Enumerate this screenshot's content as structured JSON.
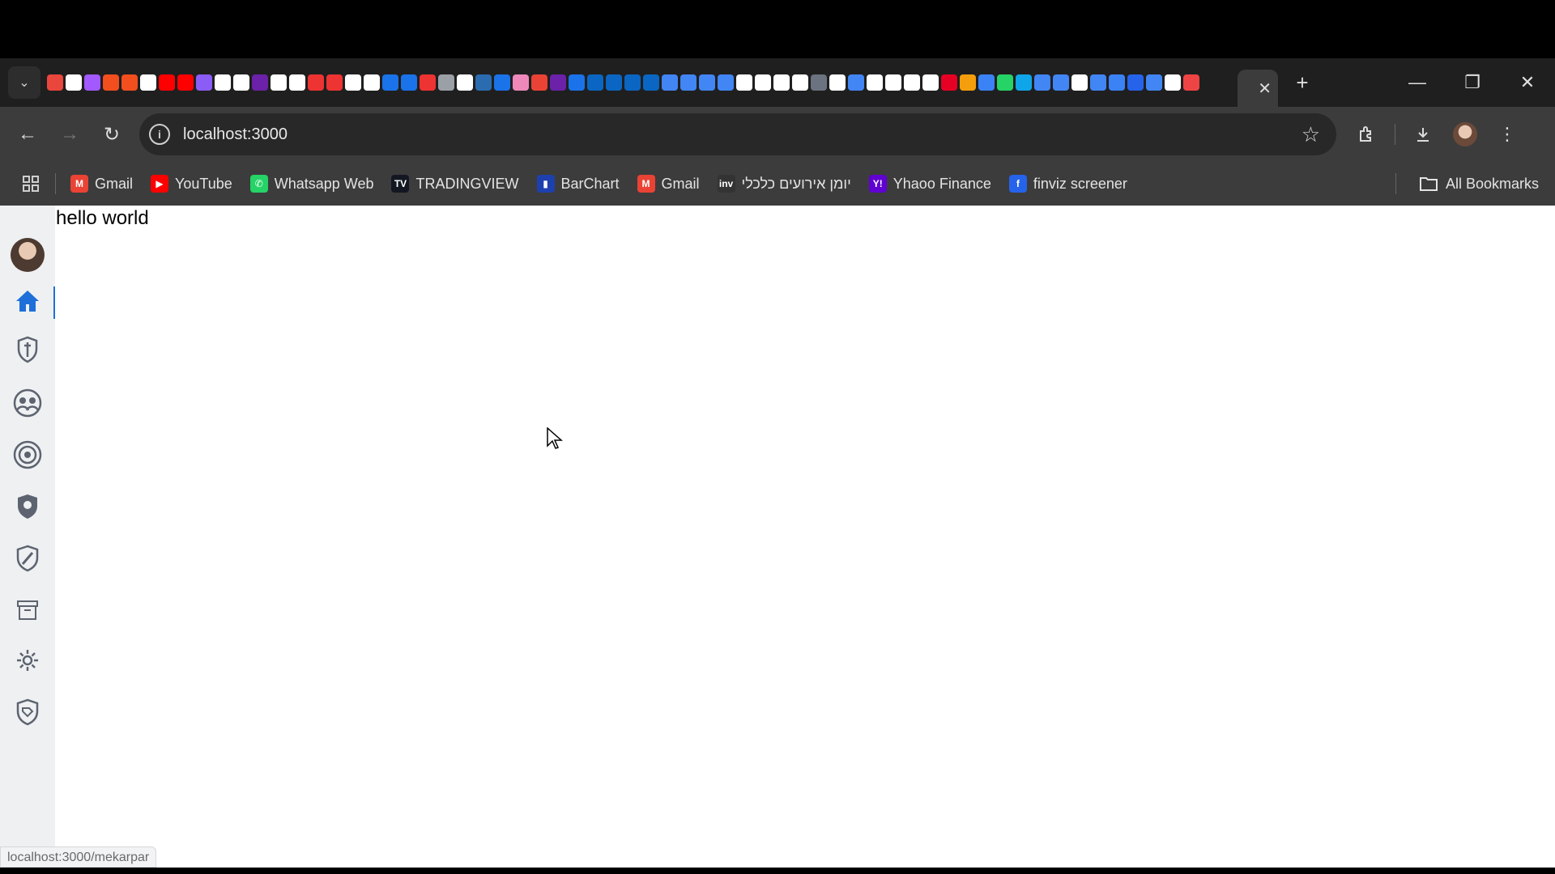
{
  "browser": {
    "tab_search_icon": "chevron-down-icon",
    "active_tab_close": "✕",
    "new_tab_label": "+",
    "window_controls": {
      "minimize": "—",
      "restore": "❐",
      "close": "✕"
    },
    "favicon_colors": [
      "#e9463d",
      "#ffffff",
      "#a259ff",
      "#f24e1e",
      "#f24e1e",
      "#ffffff",
      "#ff0000",
      "#ff0000",
      "#8b5cf6",
      "#ffffff",
      "#ffffff",
      "#6b21a8",
      "#ffffff",
      "#ffffff",
      "#e33",
      "#e33",
      "#ffffff",
      "#ffffff",
      "#1a73e8",
      "#1a73e8",
      "#e33",
      "#9aa0a6",
      "#ffffff",
      "#2b6cb0",
      "#1a73e8",
      "#e8b",
      "#ea4335",
      "#6b21a8",
      "#1a73e8",
      "#0a66c2",
      "#0a66c2",
      "#0a66c2",
      "#0a66c2",
      "#4285f4",
      "#4285f4",
      "#4285f4",
      "#4285f4",
      "#ffffff",
      "#ffffff",
      "#ffffff",
      "#ffffff",
      "#6b7280",
      "#ffffff",
      "#4285f4",
      "#ffffff",
      "#ffffff",
      "#ffffff",
      "#ffffff",
      "#e60023",
      "#f59e0b",
      "#3b82f6",
      "#25d366",
      "#0ea5e9",
      "#4285f4",
      "#4285f4",
      "#ffffff",
      "#4285f4",
      "#3b82f6",
      "#2563eb",
      "#4285f4",
      "#ffffff",
      "#ef4444"
    ]
  },
  "toolbar": {
    "url": "localhost:3000",
    "back_icon": "←",
    "forward_icon": "→",
    "reload_icon": "↻",
    "star_icon": "☆"
  },
  "bookmarks": [
    {
      "label": "Gmail",
      "icon": "M",
      "color": "#ea4335"
    },
    {
      "label": "YouTube",
      "icon": "▶",
      "color": "#ff0000"
    },
    {
      "label": "Whatsapp Web",
      "icon": "✆",
      "color": "#25d366"
    },
    {
      "label": "TRADINGVIEW",
      "icon": "TV",
      "color": "#131722"
    },
    {
      "label": "BarChart",
      "icon": "▮",
      "color": "#1e40af"
    },
    {
      "label": "Gmail",
      "icon": "M",
      "color": "#ea4335"
    },
    {
      "label": "יומן אירועים כלכלי",
      "icon": "inv",
      "color": "#333333"
    },
    {
      "label": "Yhaoo Finance",
      "icon": "Y!",
      "color": "#6001d2"
    },
    {
      "label": "finviz screener",
      "icon": "f",
      "color": "#2563eb"
    }
  ],
  "all_bookmarks_label": "All Bookmarks",
  "page": {
    "heading": "hello world",
    "status_url": "localhost:3000/mekarpar"
  },
  "sidebar_icons": [
    "home-icon",
    "shield-sword-icon",
    "users-icon",
    "target-icon",
    "lion-shield-icon",
    "pen-shield-icon",
    "archive-icon",
    "gear-icon",
    "tag-shield-icon"
  ]
}
